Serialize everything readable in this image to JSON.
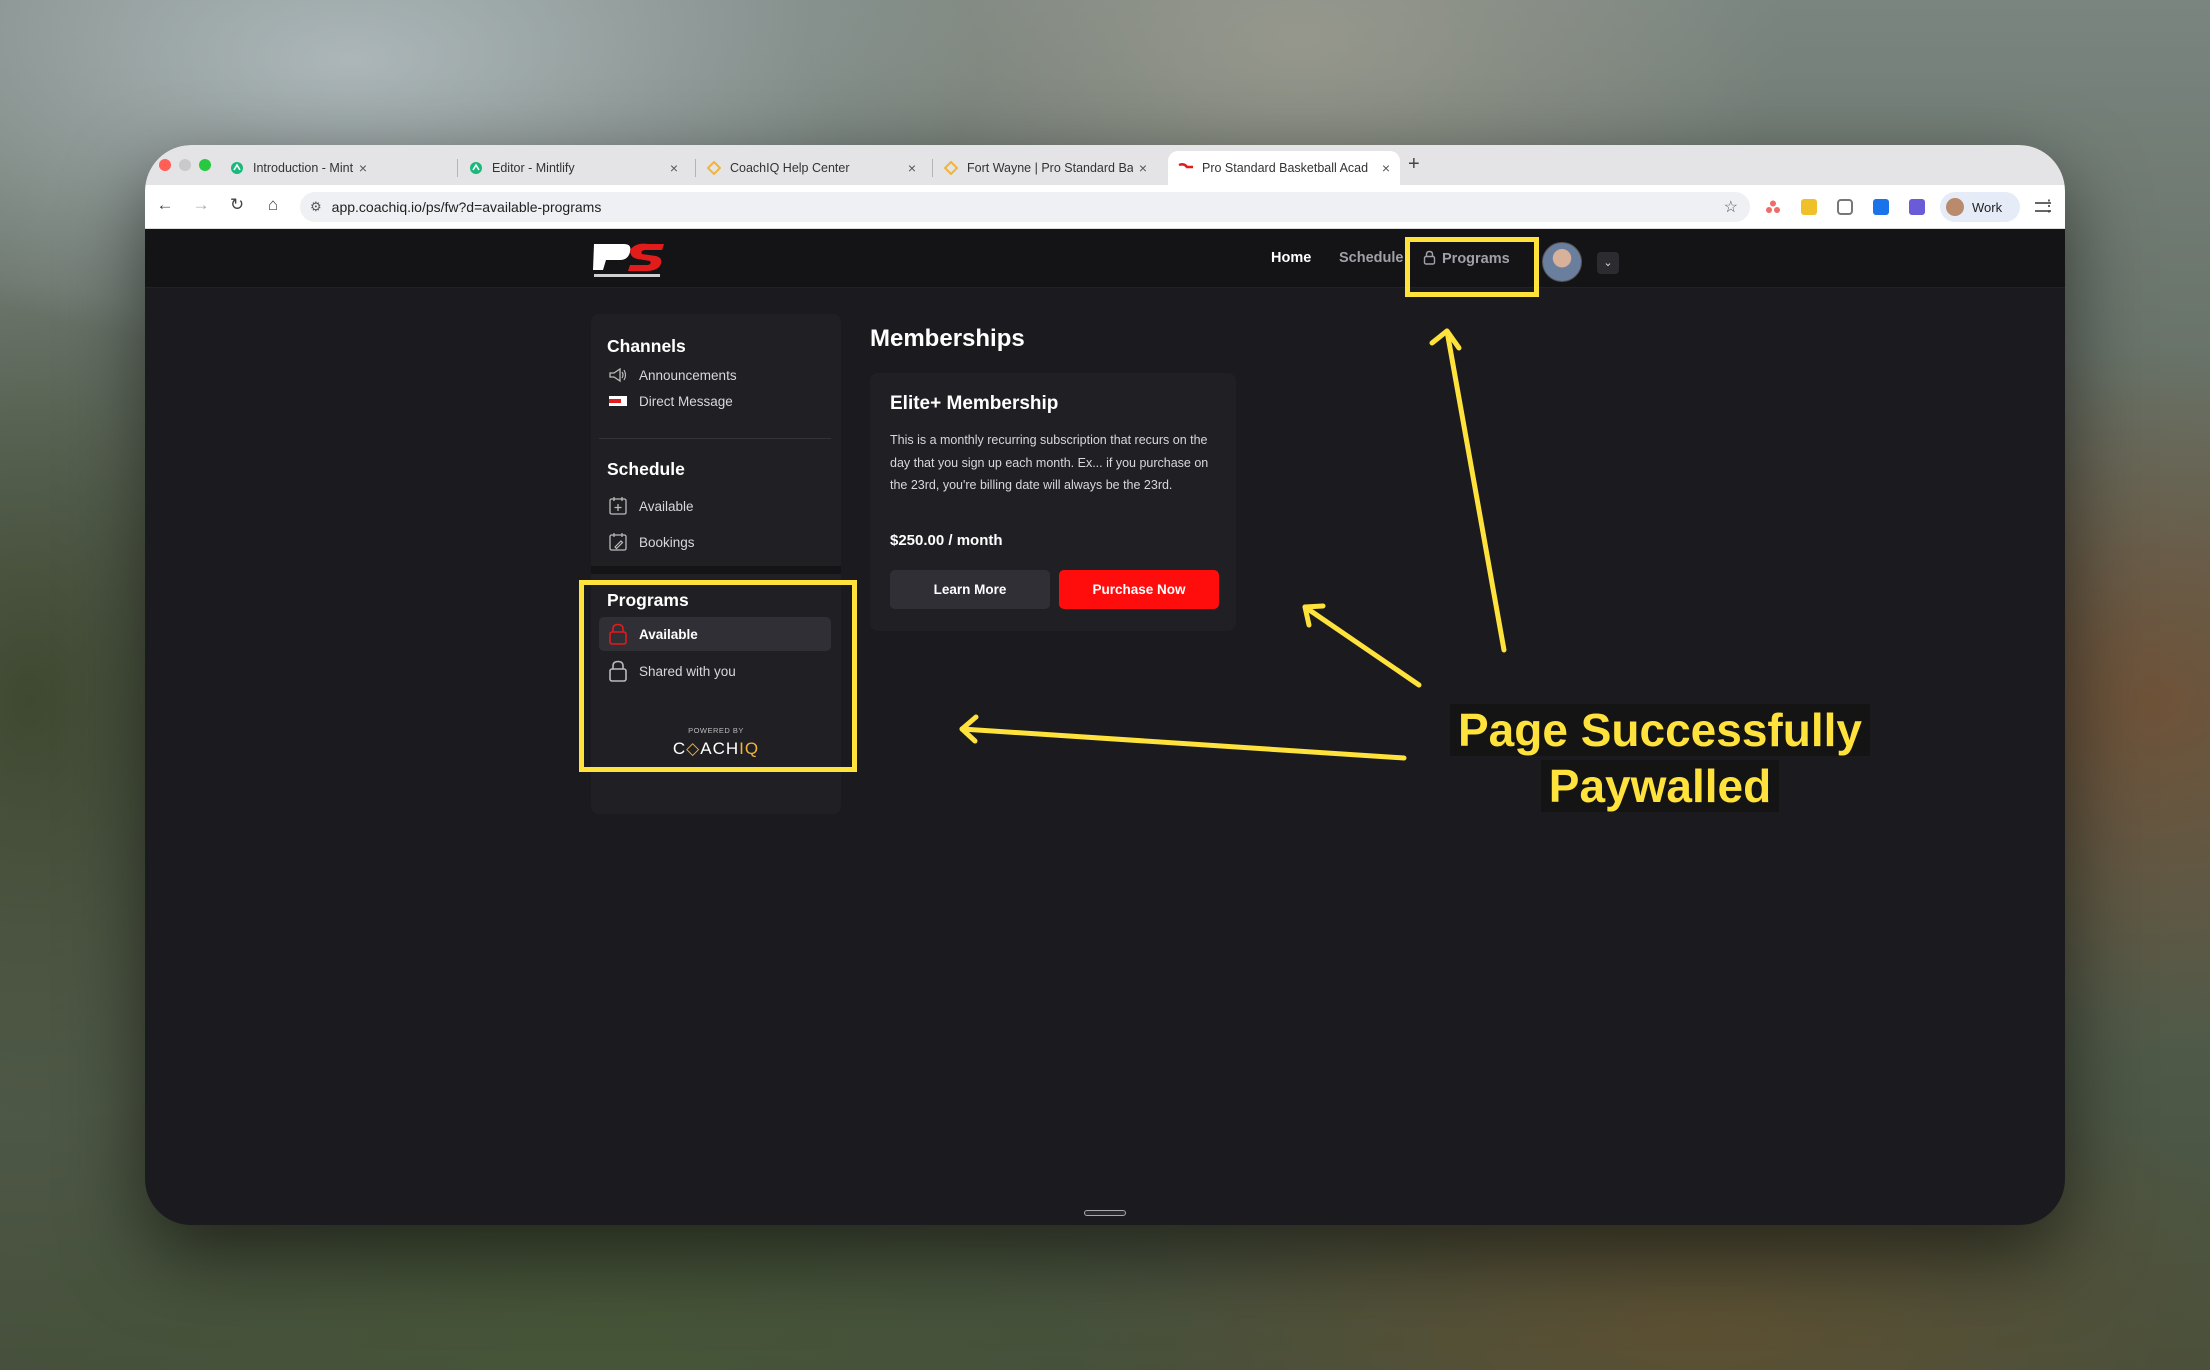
{
  "browser": {
    "tabs": [
      {
        "title": "Introduction - Mintlify",
        "close": "×"
      },
      {
        "title": "Editor - Mintlify",
        "close": "×"
      },
      {
        "title": "CoachIQ Help Center",
        "close": "×"
      },
      {
        "title": "Fort Wayne | Pro Standard Ba",
        "close": "×"
      },
      {
        "title": "Pro Standard Basketball Acad",
        "close": "×"
      }
    ],
    "new_tab": "+",
    "url": "app.coachiq.io/ps/fw?d=available-programs",
    "profile_label": "Work"
  },
  "app": {
    "nav": {
      "home": "Home",
      "schedule": "Schedule",
      "programs": "Programs"
    },
    "sidebar": {
      "channels": {
        "heading": "Channels",
        "items": [
          {
            "label": "Announcements",
            "icon": "megaphone-icon"
          },
          {
            "label": "Direct Message",
            "icon": "flag-icon"
          }
        ]
      },
      "schedule": {
        "heading": "Schedule",
        "items": [
          {
            "label": "Available",
            "icon": "calendar-add-icon"
          },
          {
            "label": "Bookings",
            "icon": "calendar-edit-icon"
          }
        ]
      },
      "programs": {
        "heading": "Programs",
        "items": [
          {
            "label": "Available",
            "icon": "lock-icon",
            "selected": true
          },
          {
            "label": "Shared with you",
            "icon": "lock-icon"
          }
        ]
      },
      "powered_by": "POWERED BY",
      "brand_a": "C",
      "brand_b": "ACH",
      "brand_c": "IQ"
    },
    "main": {
      "title": "Memberships",
      "membership": {
        "name": "Elite+ Membership",
        "description": "This is a monthly recurring subscription that recurs on the day that you sign up each month. Ex... if you purchase on the 23rd, you're billing date will always be the 23rd.",
        "price": "$250.00 / month",
        "learn_more": "Learn More",
        "purchase": "Purchase Now"
      }
    }
  },
  "annotation": {
    "line1": "Page Successfully",
    "line2": "Paywalled"
  },
  "colors": {
    "accent_red": "#ff0d0d",
    "highlight_yellow": "#ffe23b",
    "brand_gold": "#f2b33a"
  }
}
